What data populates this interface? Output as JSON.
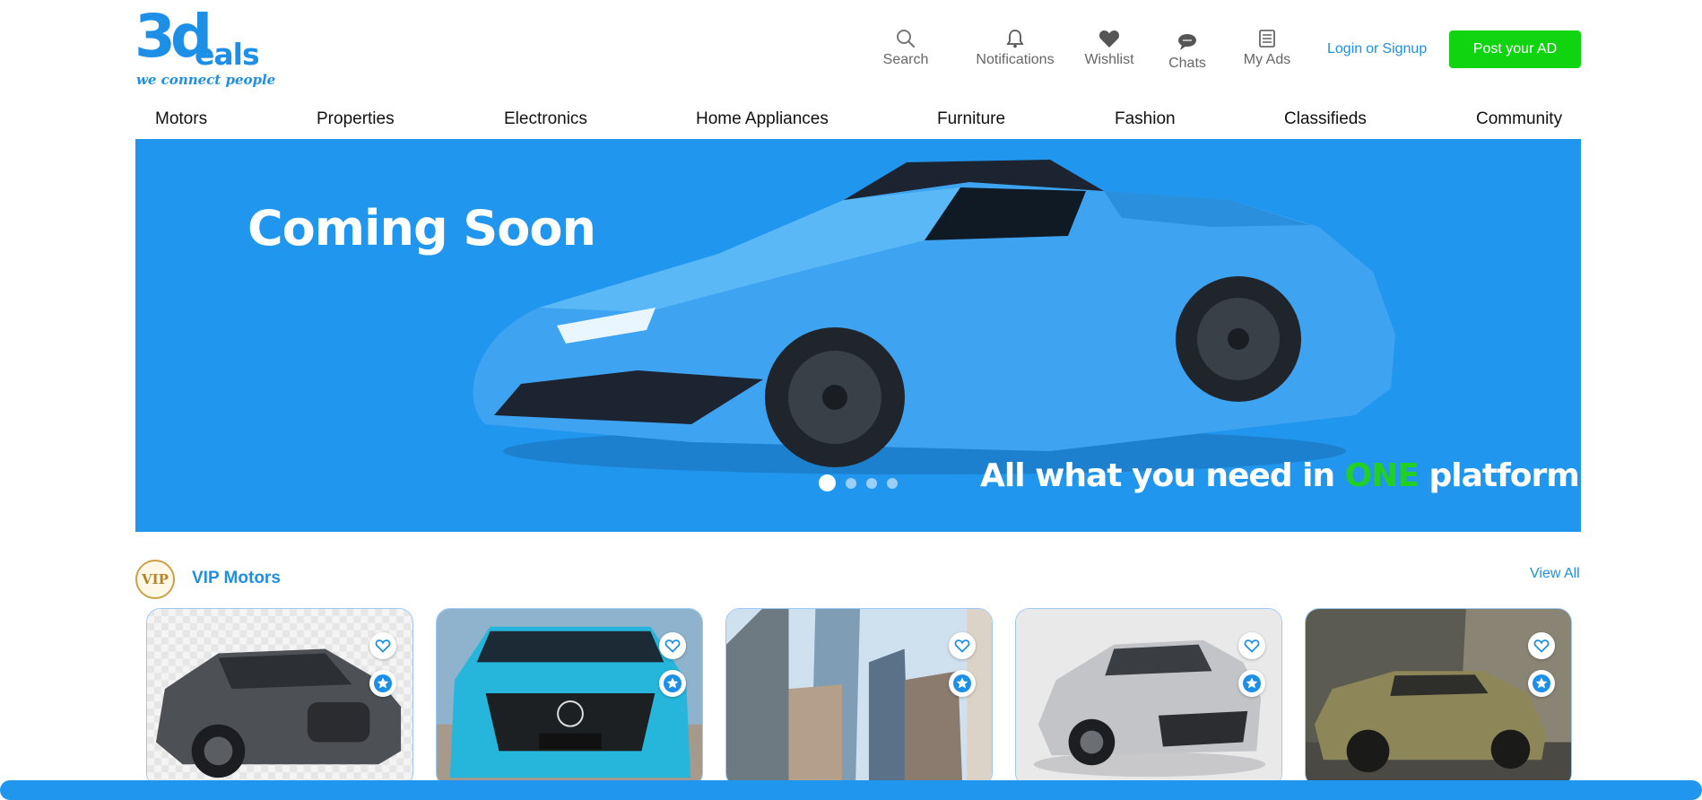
{
  "brand": {
    "logo_text": "eals",
    "logo_mark": "3d",
    "tagline": "we connect people",
    "color": "#1e8fe6"
  },
  "top_icons": [
    {
      "label": "Search",
      "icon": "search-icon"
    },
    {
      "label": "Notifications",
      "icon": "bell-icon"
    },
    {
      "label": "Wishlist",
      "icon": "heart-icon"
    },
    {
      "label": "Chats",
      "icon": "chat-icon"
    },
    {
      "label": "My Ads",
      "icon": "list-icon"
    }
  ],
  "auth": {
    "login": "Login",
    "or": "or",
    "signup": "Signup"
  },
  "post_ad_label": "Post your AD",
  "nav": [
    "Motors",
    "Properties",
    "Electronics",
    "Home Appliances",
    "Furniture",
    "Fashion",
    "Classifieds",
    "Community"
  ],
  "hero": {
    "title": "Coming Soon",
    "tag_before": "All what you need in ",
    "tag_highlight": "ONE",
    "tag_after": " platform",
    "slides": 4,
    "active_slide": 1,
    "background": "#2196ee",
    "highlight_color": "#22d022"
  },
  "vip": {
    "badge": "VIP",
    "title": "VIP Motors",
    "view_all": "View All"
  },
  "cards": [
    {
      "subject": "grey-sedan-car"
    },
    {
      "subject": "cyan-suv-car"
    },
    {
      "subject": "city-skyscrapers"
    },
    {
      "subject": "silver-sports-car"
    },
    {
      "subject": "gold-convertible-car"
    }
  ],
  "accent_green": "#10d410"
}
